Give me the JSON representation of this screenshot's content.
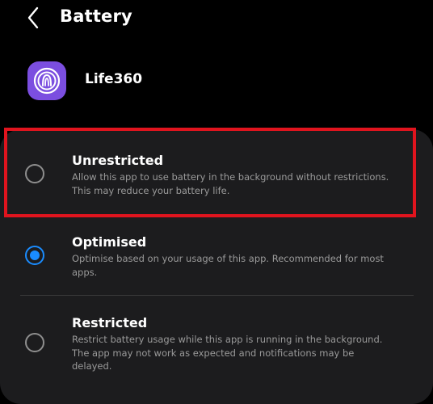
{
  "header": {
    "title": "Battery",
    "back_icon": "chevron-left-icon"
  },
  "app": {
    "name": "Life360",
    "icon": "life360-logo-icon",
    "icon_color": "#7b4ee0"
  },
  "options": [
    {
      "title": "Unrestricted",
      "description": "Allow this app to use battery in the background without restrictions. This may reduce your battery life.",
      "selected": false
    },
    {
      "title": "Optimised",
      "description": "Optimise based on your usage of this app. Recommended for most apps.",
      "selected": true
    },
    {
      "title": "Restricted",
      "description": "Restrict battery usage while this app is running in the background. The app may not work as expected and notifications may be delayed.",
      "selected": false
    }
  ],
  "colors": {
    "background": "#000000",
    "card": "#1c1c1e",
    "accent": "#1a8cff",
    "highlight": "#e0141e"
  }
}
